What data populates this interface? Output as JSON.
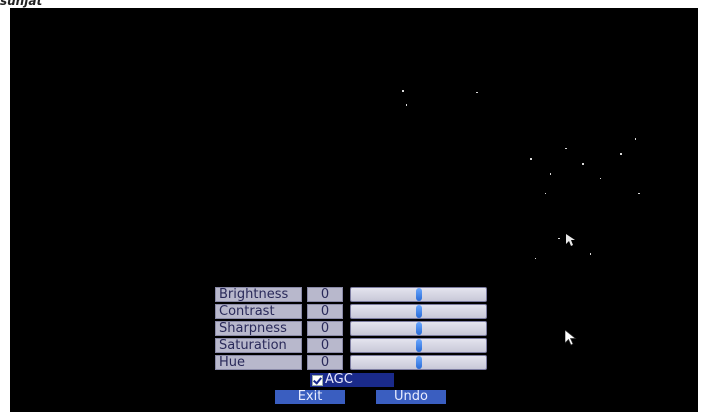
{
  "controls": [
    {
      "label": "Brightness",
      "value": "0",
      "level": 0.5
    },
    {
      "label": "Contrast",
      "value": "0",
      "level": 0.5
    },
    {
      "label": "Sharpness",
      "value": "0",
      "level": 0.5
    },
    {
      "label": "Saturation",
      "value": "0",
      "level": 0.5
    },
    {
      "label": "Hue",
      "value": "0",
      "level": 0.5
    }
  ],
  "agc": {
    "label": "AGC",
    "checked": true
  },
  "buttons": {
    "exit_label": "Exit",
    "undo_label": "Undo"
  },
  "colors": {
    "video_background": "#000000",
    "label_fill": "#b8b8cc",
    "slider_thumb": "#2a6bd6",
    "button_fill": "#3a5ec0",
    "agc_fill": "#1a2a8a"
  }
}
